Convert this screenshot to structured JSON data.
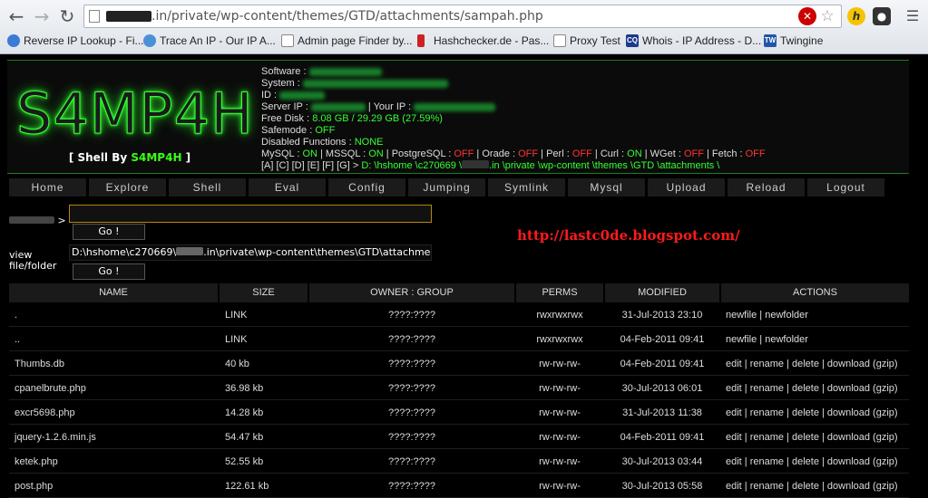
{
  "browser": {
    "url_suffix": ".in/private/wp-content/themes/GTD/attachments/sampah.php",
    "bookmarks": [
      {
        "label": "Reverse IP Lookup - Fi...",
        "icon": "globe-icon",
        "color": "#3a7bd5"
      },
      {
        "label": "Trace An IP - Our IP A...",
        "icon": "globe-icon",
        "color": "#4a90d9"
      },
      {
        "label": "Admin page Finder by...",
        "icon": "page-icon",
        "color": "#888888"
      },
      {
        "label": "Hashchecker.de - Pas...",
        "icon": "bars-icon",
        "color": "#cc2222"
      },
      {
        "label": "Proxy Test",
        "icon": "page-icon",
        "color": "#888888"
      },
      {
        "label": "Whois - IP Address - D...",
        "icon": "cq-icon",
        "color": "#1a3a8a"
      },
      {
        "label": "Twingine",
        "icon": "tw-icon",
        "color": "#2255aa"
      }
    ]
  },
  "header": {
    "logo": "S4MP4H",
    "shell_by_prefix": "[ Shell By ",
    "shell_by_name": "S4MP4H",
    "shell_by_suffix": " ]",
    "info": {
      "software_label": "Software : ",
      "system_label": "System : ",
      "id_label": "ID : ",
      "server_ip_label": "Server IP : ",
      "your_ip_label": " | Your IP : ",
      "free_disk_label": "Free Disk : ",
      "free_disk_value": "8.08 GB / 29.29 GB (27.59%)",
      "safemode_label": "Safemode : ",
      "safemode_value": "OFF",
      "disabled_label": "Disabled Functions : ",
      "disabled_value": "NONE",
      "services": [
        {
          "name": "MySQL",
          "status": "ON"
        },
        {
          "name": "MSSQL",
          "status": "ON"
        },
        {
          "name": "PostgreSQL",
          "status": "OFF"
        },
        {
          "name": "Orade",
          "status": "OFF"
        },
        {
          "name": "Perl",
          "status": "OFF"
        },
        {
          "name": "Curl",
          "status": "ON"
        },
        {
          "name": "WGet",
          "status": "OFF"
        },
        {
          "name": "Fetch",
          "status": "OFF"
        }
      ],
      "drives": "[A] [C] [D] [E] [F] [G]",
      "path_prefix": " > ",
      "path_start": "D: \\hshome \\c270669 \\",
      "path_end": ".in \\private \\wp-content \\themes \\GTD \\attachments \\"
    }
  },
  "menu": [
    "Home",
    "Explore",
    "Shell",
    "Eval",
    "Config",
    "Jumping",
    "Symlink",
    "Mysql",
    "Upload",
    "Reload",
    "Logout"
  ],
  "form": {
    "cmd_label_suffix": " >",
    "go_label": "Go !",
    "view_label_line1": "view",
    "view_label_line2": "file/folder",
    "path_start": "D:\\hshome\\c270669\\",
    "path_end": ".in\\private\\wp-content\\themes\\GTD\\attachments\\"
  },
  "blog_url": "http://lastc0de.blogspot.com/",
  "table": {
    "headers": [
      "NAME",
      "SIZE",
      "OWNER : GROUP",
      "PERMS",
      "MODIFIED",
      "ACTIONS"
    ],
    "rows": [
      {
        "name": ".",
        "size": "LINK",
        "owner": "????:????",
        "perms": "rwxrwxrwx",
        "modified": "31-Jul-2013 23:10",
        "actions": "newfile | newfolder"
      },
      {
        "name": "..",
        "size": "LINK",
        "owner": "????:????",
        "perms": "rwxrwxrwx",
        "modified": "04-Feb-2011 09:41",
        "actions": "newfile | newfolder"
      },
      {
        "name": "Thumbs.db",
        "size": "40 kb",
        "owner": "????:????",
        "perms": "rw-rw-rw-",
        "modified": "04-Feb-2011 09:41",
        "actions": "edit | rename | delete | download (gzip)"
      },
      {
        "name": "cpanelbrute.php",
        "size": "36.98 kb",
        "owner": "????:????",
        "perms": "rw-rw-rw-",
        "modified": "30-Jul-2013 06:01",
        "actions": "edit | rename | delete | download (gzip)"
      },
      {
        "name": "excr5698.php",
        "size": "14.28 kb",
        "owner": "????:????",
        "perms": "rw-rw-rw-",
        "modified": "31-Jul-2013 11:38",
        "actions": "edit | rename | delete | download (gzip)"
      },
      {
        "name": "jquery-1.2.6.min.js",
        "size": "54.47 kb",
        "owner": "????:????",
        "perms": "rw-rw-rw-",
        "modified": "04-Feb-2011 09:41",
        "actions": "edit | rename | delete | download (gzip)"
      },
      {
        "name": "ketek.php",
        "size": "52.55 kb",
        "owner": "????:????",
        "perms": "rw-rw-rw-",
        "modified": "30-Jul-2013 03:44",
        "actions": "edit | rename | delete | download (gzip)"
      },
      {
        "name": "post.php",
        "size": "122.61 kb",
        "owner": "????:????",
        "perms": "rw-rw-rw-",
        "modified": "30-Jul-2013 05:58",
        "actions": "edit | rename | delete | download (gzip)"
      }
    ]
  }
}
